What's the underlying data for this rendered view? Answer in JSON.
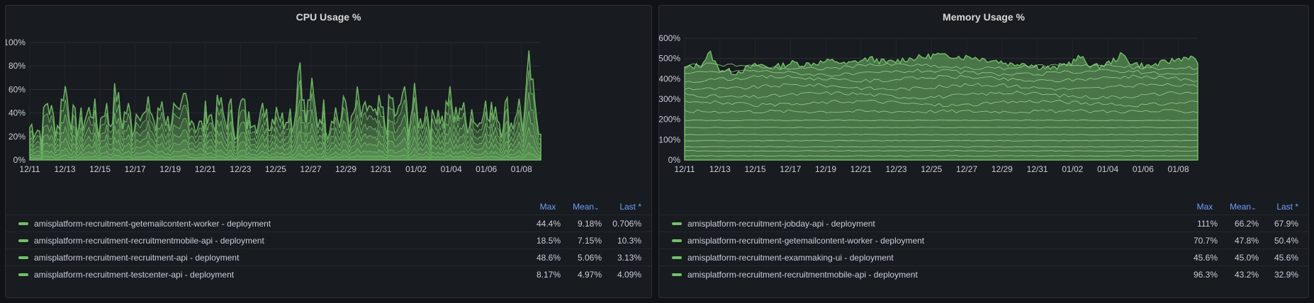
{
  "panels": [
    {
      "title": "CPU Usage %",
      "legend_headers": {
        "max": "Max",
        "mean": "Mean",
        "mean_sort_icon": "chevron-down-icon",
        "last": "Last *"
      },
      "legend": [
        {
          "name": "amisplatform-recruitment-getemailcontent-worker - deployment",
          "max": "44.4%",
          "mean": "9.18%",
          "last": "0.706%"
        },
        {
          "name": "amisplatform-recruitment-recruitmentmobile-api - deployment",
          "max": "18.5%",
          "mean": "7.15%",
          "last": "10.3%"
        },
        {
          "name": "amisplatform-recruitment-recruitment-api - deployment",
          "max": "48.6%",
          "mean": "5.06%",
          "last": "3.13%"
        },
        {
          "name": "amisplatform-recruitment-testcenter-api - deployment",
          "max": "8.17%",
          "mean": "4.97%",
          "last": "4.09%"
        }
      ]
    },
    {
      "title": "Memory Usage %",
      "legend_headers": {
        "max": "Max",
        "mean": "Mean",
        "mean_sort_icon": "chevron-down-icon",
        "last": "Last *"
      },
      "legend": [
        {
          "name": "amisplatform-recruitment-jobday-api - deployment",
          "max": "111%",
          "mean": "66.2%",
          "last": "67.9%"
        },
        {
          "name": "amisplatform-recruitment-getemailcontent-worker - deployment",
          "max": "70.7%",
          "mean": "47.8%",
          "last": "50.4%"
        },
        {
          "name": "amisplatform-recruitment-exammaking-ui - deployment",
          "max": "45.6%",
          "mean": "45.0%",
          "last": "45.6%"
        },
        {
          "name": "amisplatform-recruitment-recruitmentmobile-api - deployment",
          "max": "96.3%",
          "mean": "43.2%",
          "last": "32.9%"
        }
      ]
    }
  ],
  "chart_data": [
    {
      "type": "area",
      "stacked": true,
      "title": "CPU Usage %",
      "x_tick_labels": [
        "12/11",
        "12/13",
        "12/15",
        "12/17",
        "12/19",
        "12/21",
        "12/23",
        "12/25",
        "12/27",
        "12/29",
        "12/31",
        "01/02",
        "01/04",
        "01/06",
        "01/08"
      ],
      "y_tick_labels": [
        "0%",
        "20%",
        "40%",
        "60%",
        "80%",
        "100%"
      ],
      "ylim": [
        0,
        100
      ],
      "grid": true,
      "legend_position": "bottom",
      "color": "#73bf69",
      "series": [
        {
          "name": "amisplatform-recruitment-getemailcontent-worker - deployment",
          "max": 44.4,
          "mean": 9.18,
          "last": 0.706
        },
        {
          "name": "amisplatform-recruitment-recruitmentmobile-api - deployment",
          "max": 18.5,
          "mean": 7.15,
          "last": 10.3
        },
        {
          "name": "amisplatform-recruitment-recruitment-api - deployment",
          "max": 48.6,
          "mean": 5.06,
          "last": 3.13
        },
        {
          "name": "amisplatform-recruitment-testcenter-api - deployment",
          "max": 8.17,
          "mean": 4.97,
          "last": 4.09
        }
      ],
      "upper_envelope_samples": [
        28,
        30,
        22,
        52,
        35,
        28,
        66,
        40,
        30,
        32,
        38,
        45,
        26,
        48,
        30,
        60,
        32,
        44,
        28,
        50,
        34,
        46,
        26,
        52,
        30,
        42,
        28,
        55,
        40,
        30,
        26,
        46,
        30,
        48,
        33,
        42,
        27,
        50,
        30,
        44,
        28,
        48,
        30,
        50,
        32,
        46,
        30,
        90,
        30,
        62,
        32,
        44,
        28,
        46,
        30,
        50,
        26,
        52,
        32,
        48,
        30,
        44,
        28,
        54,
        30,
        60,
        32,
        52,
        30,
        46,
        28,
        48,
        30,
        56,
        32,
        50,
        30,
        44,
        28,
        52,
        30,
        50,
        30,
        46,
        28,
        50,
        30,
        84,
        40,
        30
      ]
    },
    {
      "type": "area",
      "stacked": false,
      "title": "Memory Usage %",
      "x_tick_labels": [
        "12/11",
        "12/13",
        "12/15",
        "12/17",
        "12/19",
        "12/21",
        "12/23",
        "12/25",
        "12/27",
        "12/29",
        "12/31",
        "01/02",
        "01/04",
        "01/06",
        "01/08"
      ],
      "y_tick_labels": [
        "0%",
        "100%",
        "200%",
        "300%",
        "400%",
        "500%",
        "600%"
      ],
      "ylim": [
        0,
        600
      ],
      "grid": true,
      "legend_position": "bottom",
      "color": "#73bf69",
      "series": [
        {
          "name": "amisplatform-recruitment-jobday-api - deployment",
          "max": 111,
          "mean": 66.2,
          "last": 67.9
        },
        {
          "name": "amisplatform-recruitment-getemailcontent-worker - deployment",
          "max": 70.7,
          "mean": 47.8,
          "last": 50.4
        },
        {
          "name": "amisplatform-recruitment-exammaking-ui - deployment",
          "max": 45.6,
          "mean": 45.0,
          "last": 45.6
        },
        {
          "name": "amisplatform-recruitment-recruitmentmobile-api - deployment",
          "max": 96.3,
          "mean": 43.2,
          "last": 32.9
        }
      ],
      "band_levels": [
        20,
        45,
        65,
        95,
        125,
        160,
        195,
        240,
        280,
        320,
        360,
        400,
        430,
        460
      ],
      "upper_envelope_samples": [
        450,
        460,
        470,
        530,
        450,
        440,
        430,
        445,
        460,
        470,
        455,
        460,
        470,
        480,
        470,
        475,
        480,
        485,
        490,
        470,
        480,
        490,
        500,
        490,
        480,
        485,
        495,
        500,
        505,
        510,
        520,
        510,
        515,
        505,
        510,
        500,
        495,
        490,
        480,
        470,
        480,
        470,
        460,
        455,
        450,
        470,
        480,
        510,
        470,
        460,
        470,
        490,
        520,
        480,
        470,
        460,
        470,
        480,
        490,
        500,
        510,
        480
      ]
    }
  ]
}
